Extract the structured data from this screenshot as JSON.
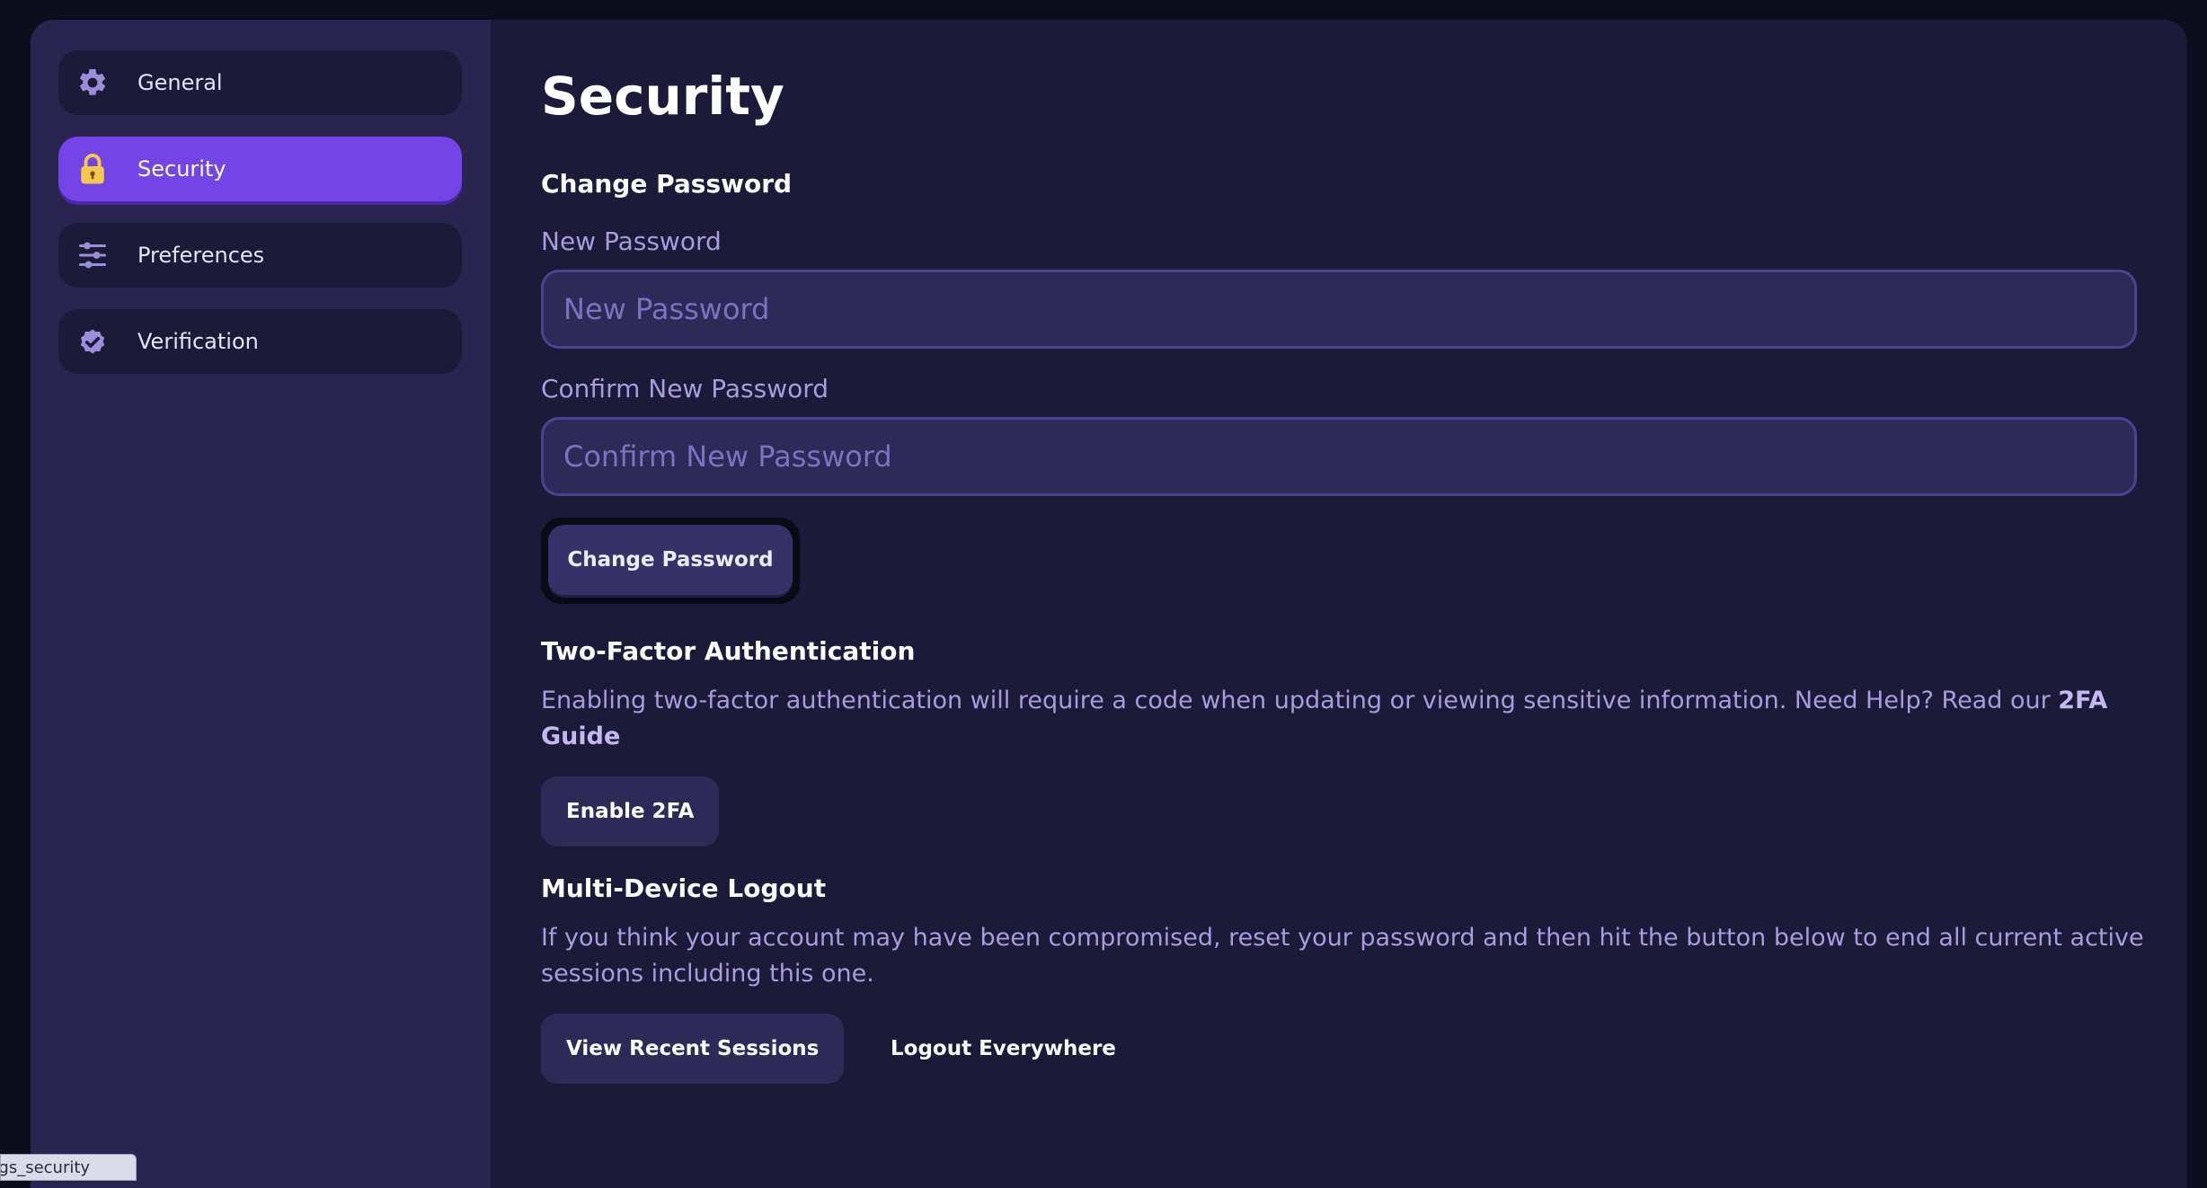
{
  "sidebar": {
    "items": [
      {
        "label": "General",
        "icon": "gear-icon",
        "active": false
      },
      {
        "label": "Security",
        "icon": "lock-icon",
        "active": true
      },
      {
        "label": "Preferences",
        "icon": "sliders-icon",
        "active": false
      },
      {
        "label": "Verification",
        "icon": "verified-badge-icon",
        "active": false
      }
    ]
  },
  "main": {
    "title": "Security",
    "change_password": {
      "heading": "Change Password",
      "new_label": "New Password",
      "new_placeholder": "New Password",
      "confirm_label": "Confirm New Password",
      "confirm_placeholder": "Confirm New Password",
      "button": "Change Password"
    },
    "two_factor": {
      "heading": "Two-Factor Authentication",
      "description": "Enabling two-factor authentication will require a code when updating or viewing sensitive information. Need Help? Read our ",
      "link": "2FA Guide",
      "button": "Enable 2FA"
    },
    "logout": {
      "heading": "Multi-Device Logout",
      "description": "If you think your account may have been compromised, reset your password and then hit the button below to end all current active sessions including this one.",
      "sessions_button": "View Recent Sessions",
      "logout_button": "Logout Everywhere"
    }
  },
  "status_tooltip": "ngs_security",
  "colors": {
    "accent": "#7544e6",
    "sidebar_bg": "#2a2550",
    "main_bg": "#1c1a39",
    "muted_text": "#a99bdc",
    "lock_yellow": "#f2c94c"
  }
}
